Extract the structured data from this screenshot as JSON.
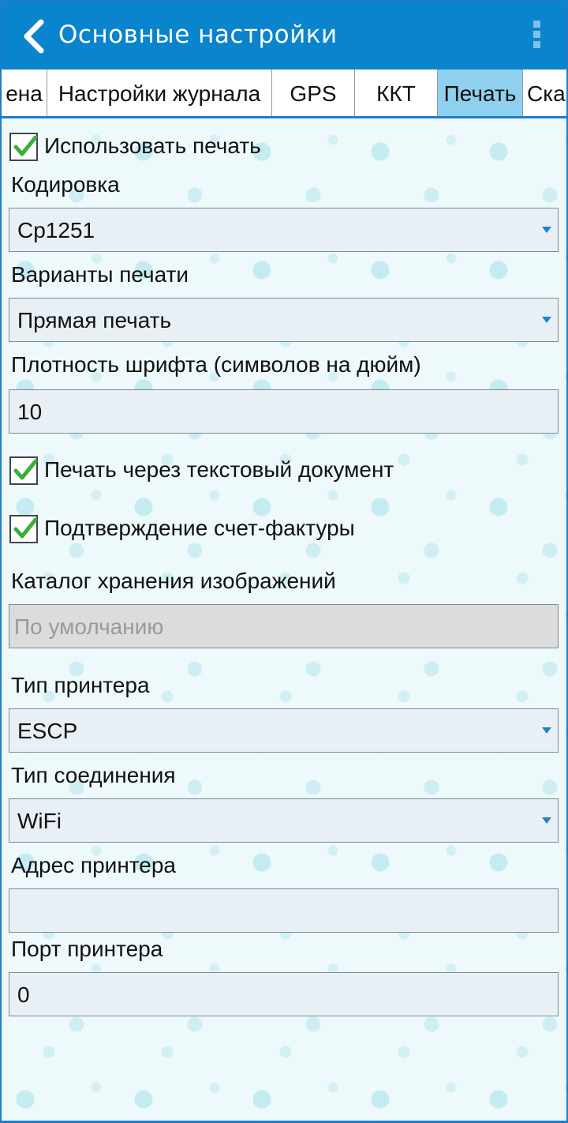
{
  "appbar": {
    "title": "Основные настройки",
    "back_icon": "chevron-left-icon",
    "menu_icon": "overflow-menu-icon"
  },
  "tabs": [
    {
      "label": "ена",
      "active": false
    },
    {
      "label": "Настройки журнала",
      "active": false
    },
    {
      "label": "GPS",
      "active": false
    },
    {
      "label": "ККТ",
      "active": false
    },
    {
      "label": "Печать",
      "active": true
    },
    {
      "label": "Ска",
      "active": false
    }
  ],
  "form": {
    "use_print": {
      "label": "Использовать печать",
      "checked": true
    },
    "encoding": {
      "label": "Кодировка",
      "value": "Cp1251"
    },
    "print_variant": {
      "label": "Варианты печати",
      "value": "Прямая печать"
    },
    "font_density": {
      "label": "Плотность шрифта (символов на дюйм)",
      "value": "10"
    },
    "print_text_doc": {
      "label": "Печать через текстовый документ",
      "checked": true
    },
    "invoice_confirm": {
      "label": "Подтверждение счет-фактуры",
      "checked": true
    },
    "image_catalog": {
      "label": "Каталог хранения изображений",
      "placeholder": "По умолчанию"
    },
    "printer_type": {
      "label": "Тип принтера",
      "value": "ESCP"
    },
    "connection_type": {
      "label": "Тип соединения",
      "value": "WiFi"
    },
    "printer_address": {
      "label": "Адрес принтера",
      "value": ""
    },
    "printer_port": {
      "label": "Порт принтера",
      "value": "0"
    }
  },
  "colors": {
    "appbar": "#0a84cc",
    "active_tab": "#8fd0ee",
    "checkmark": "#3cae3c",
    "field_bg": "#e8f0f6"
  }
}
